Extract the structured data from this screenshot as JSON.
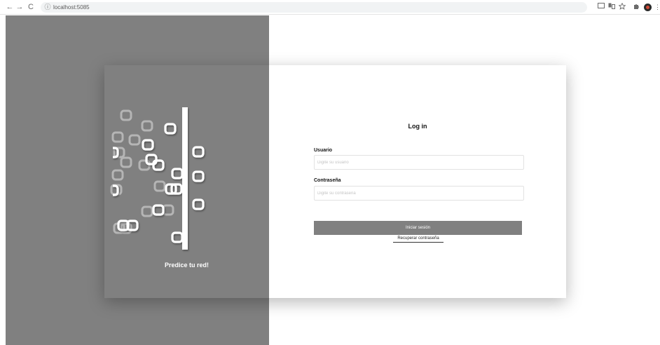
{
  "browser": {
    "url": "localhost:5085",
    "back_glyph": "←",
    "forward_glyph": "→",
    "reload_glyph": "C",
    "info_glyph": "ⓘ",
    "menu_glyph": "⋮"
  },
  "brand": {
    "tagline": "Predice tu red!",
    "panel_color": "#808080"
  },
  "login": {
    "title": "Log in",
    "username_label": "Usuario",
    "username_placeholder": "Digite su usuario",
    "username_value": "",
    "password_label": "Contraseña",
    "password_placeholder": "Digite su contraseña",
    "password_value": "",
    "submit_label": "Iniciar sesión",
    "recover_link": "Recuperar contraseña"
  }
}
